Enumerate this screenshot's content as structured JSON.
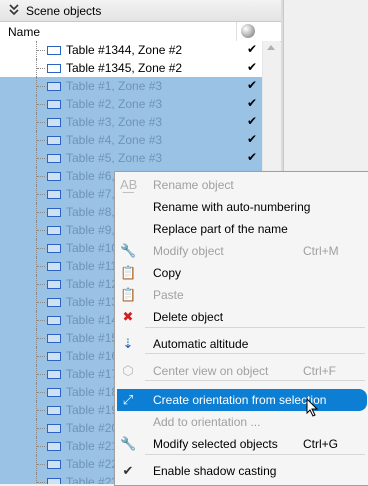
{
  "panel": {
    "title": "Scene objects",
    "column_name": "Name"
  },
  "rows": [
    {
      "label": "Table #1344, Zone #2",
      "selected": false,
      "checked": "✔"
    },
    {
      "label": "Table #1345, Zone #2",
      "selected": false,
      "checked": "✔"
    },
    {
      "label": "Table #1, Zone #3",
      "selected": true,
      "checked": "✔"
    },
    {
      "label": "Table #2, Zone #3",
      "selected": true,
      "checked": "✔"
    },
    {
      "label": "Table #3, Zone #3",
      "selected": true,
      "checked": "✔"
    },
    {
      "label": "Table #4, Zone #3",
      "selected": true,
      "checked": "✔"
    },
    {
      "label": "Table #5, Zone #3",
      "selected": true,
      "checked": "✔"
    },
    {
      "label": "Table #6,",
      "selected": true,
      "checked": ""
    },
    {
      "label": "Table #7,",
      "selected": true,
      "checked": ""
    },
    {
      "label": "Table #8,",
      "selected": true,
      "checked": ""
    },
    {
      "label": "Table #9,",
      "selected": true,
      "checked": ""
    },
    {
      "label": "Table #10",
      "selected": true,
      "checked": ""
    },
    {
      "label": "Table #11",
      "selected": true,
      "checked": ""
    },
    {
      "label": "Table #12",
      "selected": true,
      "checked": ""
    },
    {
      "label": "Table #13",
      "selected": true,
      "checked": ""
    },
    {
      "label": "Table #14",
      "selected": true,
      "checked": ""
    },
    {
      "label": "Table #15",
      "selected": true,
      "checked": ""
    },
    {
      "label": "Table #16",
      "selected": true,
      "checked": ""
    },
    {
      "label": "Table #17",
      "selected": true,
      "checked": ""
    },
    {
      "label": "Table #18",
      "selected": true,
      "checked": ""
    },
    {
      "label": "Table #19",
      "selected": true,
      "checked": ""
    },
    {
      "label": "Table #20",
      "selected": true,
      "checked": ""
    },
    {
      "label": "Table #21",
      "selected": true,
      "checked": ""
    },
    {
      "label": "Table #22",
      "selected": true,
      "checked": ""
    },
    {
      "label": "Table #23",
      "selected": true,
      "checked": ""
    }
  ],
  "context_menu": {
    "items": [
      {
        "label": "Rename object",
        "shortcut": "",
        "icon": "rename-icon",
        "glyph": "A͟B",
        "disabled": true
      },
      {
        "label": "Rename with auto-numbering",
        "shortcut": "",
        "icon": "",
        "glyph": "",
        "disabled": false
      },
      {
        "label": "Replace part of the name",
        "shortcut": "",
        "icon": "",
        "glyph": "",
        "disabled": false
      },
      {
        "label": "Modify object",
        "shortcut": "Ctrl+M",
        "icon": "wrench-icon",
        "glyph": "🔧",
        "disabled": true
      },
      {
        "label": "Copy",
        "shortcut": "",
        "icon": "copy-icon",
        "glyph": "📋",
        "disabled": false
      },
      {
        "label": "Paste",
        "shortcut": "",
        "icon": "paste-icon",
        "glyph": "📋",
        "disabled": true
      },
      {
        "label": "Delete object",
        "shortcut": "",
        "icon": "delete-icon",
        "glyph": "✖",
        "disabled": false
      },
      {
        "label": "Automatic altitude",
        "shortcut": "",
        "icon": "altitude-icon",
        "glyph": "⇣",
        "disabled": false
      },
      {
        "label": "Center view on object",
        "shortcut": "Ctrl+F",
        "icon": "center-view-icon",
        "glyph": "⬡",
        "disabled": true
      },
      {
        "label": "Create orientation from selection",
        "shortcut": "",
        "icon": "orientation-icon",
        "glyph": "⤢",
        "disabled": false,
        "highlighted": true
      },
      {
        "label": "Add to orientation ...",
        "shortcut": "",
        "icon": "",
        "glyph": "",
        "disabled": true
      },
      {
        "label": "Modify selected objects",
        "shortcut": "Ctrl+G",
        "icon": "wrench-icon",
        "glyph": "🔧",
        "disabled": false
      },
      {
        "label": "Enable shadow casting",
        "shortcut": "",
        "icon": "check-icon",
        "glyph": "✔",
        "disabled": false
      }
    ]
  },
  "colors": {
    "selection": "#99c2e5",
    "highlight": "#0c7fd4",
    "delete_red": "#d21f1f"
  }
}
